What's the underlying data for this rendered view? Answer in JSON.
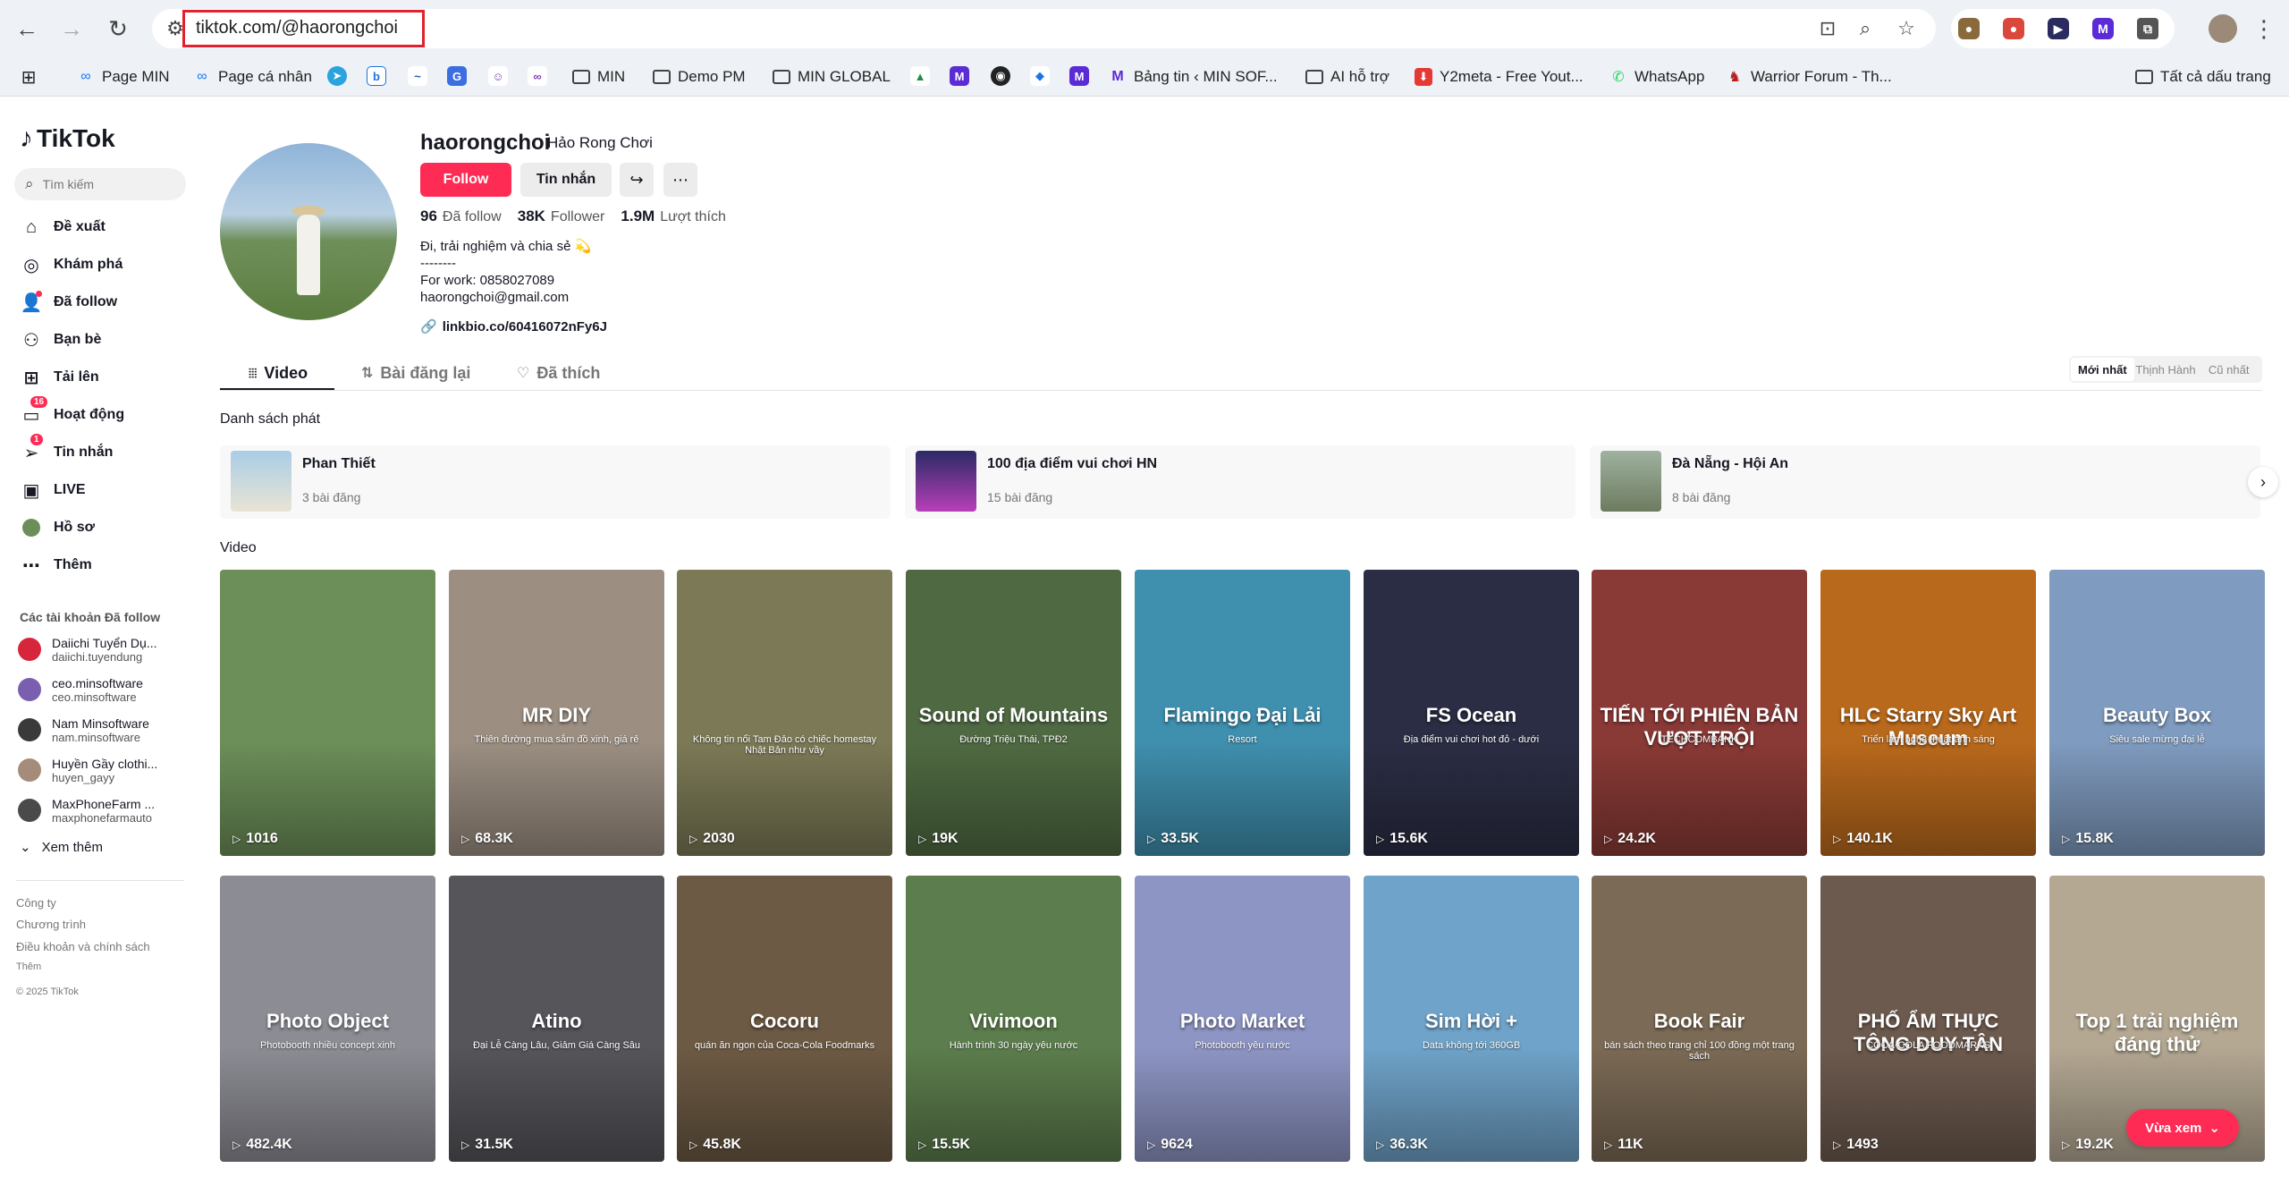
{
  "browser": {
    "url": "tiktok.com/@haorongchoi",
    "bookmarks": [
      "Page MIN",
      "Page cá nhân",
      "MIN",
      "Demo PM",
      "MIN GLOBAL",
      "Bảng tin ‹ MIN SOF...",
      "AI hỗ trợ",
      "Y2meta - Free Yout...",
      "WhatsApp",
      "Warrior Forum - Th...",
      "Tất cả dấu trang"
    ]
  },
  "sidebar": {
    "logo": "TikTok",
    "search_placeholder": "Tìm kiếm",
    "nav": [
      {
        "label": "Đề xuất",
        "icon": "home-icon"
      },
      {
        "label": "Khám phá",
        "icon": "compass-icon"
      },
      {
        "label": "Đã follow",
        "icon": "user-follow-icon"
      },
      {
        "label": "Bạn bè",
        "icon": "friends-icon"
      },
      {
        "label": "Tải lên",
        "icon": "upload-icon"
      },
      {
        "label": "Hoạt động",
        "icon": "activity-icon",
        "badge": "16"
      },
      {
        "label": "Tin nhắn",
        "icon": "message-icon",
        "badge": "1"
      },
      {
        "label": "LIVE",
        "icon": "live-icon"
      },
      {
        "label": "Hồ sơ",
        "icon": "profile-icon"
      },
      {
        "label": "Thêm",
        "icon": "more-icon"
      }
    ],
    "following_title": "Các tài khoản Đã follow",
    "following": [
      {
        "name": "Daiichi Tuyển Dụ...",
        "handle": "daiichi.tuyendung",
        "color": "#d6263b"
      },
      {
        "name": "ceo.minsoftware",
        "handle": "ceo.minsoftware",
        "color": "#7a5fb0"
      },
      {
        "name": "Nam Minsoftware",
        "handle": "nam.minsoftware",
        "color": "#3a3a3a"
      },
      {
        "name": "Huyền Gầy clothi...",
        "handle": "huyen_gayy",
        "color": "#a58c7a"
      },
      {
        "name": "MaxPhoneFarm ...",
        "handle": "maxphonefarmauto",
        "color": "#4a4a4a"
      }
    ],
    "see_more": "Xem thêm",
    "footer": [
      "Công ty",
      "Chương trình",
      "Điều khoản và chính sách",
      "Thêm",
      "© 2025 TikTok"
    ]
  },
  "profile": {
    "username": "haorongchoi",
    "nickname": "Hảo Rong Chơi",
    "follow_label": "Follow",
    "message_label": "Tin nhắn",
    "stats": [
      {
        "value": "96",
        "label": "Đã follow"
      },
      {
        "value": "38K",
        "label": "Follower"
      },
      {
        "value": "1.9M",
        "label": "Lượt thích"
      }
    ],
    "bio": [
      "Đi, trải nghiệm và chia sẻ 💫",
      "--------",
      "For work: 0858027089",
      "haorongchoi@gmail.com"
    ],
    "link": "linkbio.co/60416072nFy6J"
  },
  "tabs": [
    {
      "label": "Video",
      "icon": "grid-icon"
    },
    {
      "label": "Bài đăng lại",
      "icon": "repost-icon"
    },
    {
      "label": "Đã thích",
      "icon": "heart-icon"
    }
  ],
  "sort": [
    "Mới nhất",
    "Thịnh Hành",
    "Cũ nhất"
  ],
  "playlists_title": "Danh sách phát",
  "playlists": [
    {
      "name": "Phan Thiết",
      "count": "3 bài đăng"
    },
    {
      "name": "100 địa điểm vui chơi HN",
      "count": "15 bài đăng"
    },
    {
      "name": "Đà Nẵng - Hội An",
      "count": "8 bài đăng"
    }
  ],
  "videos_title": "Video",
  "videos": [
    {
      "views": "1016",
      "title": "",
      "subtitle": "",
      "bg": "#6c8f59"
    },
    {
      "views": "68.3K",
      "title": "MR DIY",
      "subtitle": "Thiên đường mua sắm đồ xinh, giá rẻ",
      "bg": "#9c8f82"
    },
    {
      "views": "2030",
      "title": "",
      "subtitle": "Không tin nổi Tam Đảo có chiếc homestay Nhật Bản như vầy",
      "bg": "#7c7a56"
    },
    {
      "views": "19K",
      "title": "Sound of Mountains",
      "subtitle": "Đường Triệu Thái, TPĐ2",
      "bg": "#4f6a42"
    },
    {
      "views": "33.5K",
      "title": "Flamingo Đại Lải",
      "subtitle": "Resort",
      "bg": "#3f8fae"
    },
    {
      "views": "15.6K",
      "title": "FS Ocean",
      "subtitle": "Địa điểm vui chơi hot đỏ - dưới",
      "bg": "#2b2d44"
    },
    {
      "views": "24.2K",
      "title": "TIẾN TỚI PHIÊN BẢN VƯỢT TRỘI",
      "subtitle": "TECHCOMBANK",
      "bg": "#8a3a36"
    },
    {
      "views": "140.1K",
      "title": "HLC Starry Sky Art Museum",
      "subtitle": "Triển lãm nghệ thuật ánh sáng",
      "bg": "#b9691c"
    },
    {
      "views": "15.8K",
      "title": "Beauty Box",
      "subtitle": "Siêu sale mừng đại lễ",
      "bg": "#7f9bbf"
    },
    {
      "views": "482.4K",
      "title": "Photo Object",
      "subtitle": "Photobooth nhiều concept xinh",
      "bg": "#8c8c94"
    },
    {
      "views": "31.5K",
      "title": "Atino",
      "subtitle": "Đại Lễ Càng Lâu, Giảm Giá Càng Sâu",
      "bg": "#55555a"
    },
    {
      "views": "45.8K",
      "title": "Cocoru",
      "subtitle": "quán ăn ngon của Coca-Cola Foodmarks",
      "bg": "#6d5a44"
    },
    {
      "views": "15.5K",
      "title": "Vivimoon",
      "subtitle": "Hành trình 30 ngày yêu nước",
      "bg": "#5c7d4d"
    },
    {
      "views": "9624",
      "title": "Photo Market",
      "subtitle": "Photobooth yêu nước",
      "bg": "#8d95c4"
    },
    {
      "views": "36.3K",
      "title": "Sim Hời +",
      "subtitle": "Data không tới 360GB",
      "bg": "#6fa3c9"
    },
    {
      "views": "11K",
      "title": "Book Fair",
      "subtitle": "bán sách theo trang chỉ 100 đồng một trang sách",
      "bg": "#7b6a55"
    },
    {
      "views": "1493",
      "title": "PHỐ ẨM THỰC TÔNG DUY TÂN",
      "subtitle": "COCA-COLA FOODMARKS",
      "bg": "#6d5a4e"
    },
    {
      "views": "19.2K",
      "title": "Top 1 trải nghiệm đáng thử",
      "subtitle": "",
      "bg": "#b4a893"
    }
  ],
  "recent_label": "Vừa xem"
}
